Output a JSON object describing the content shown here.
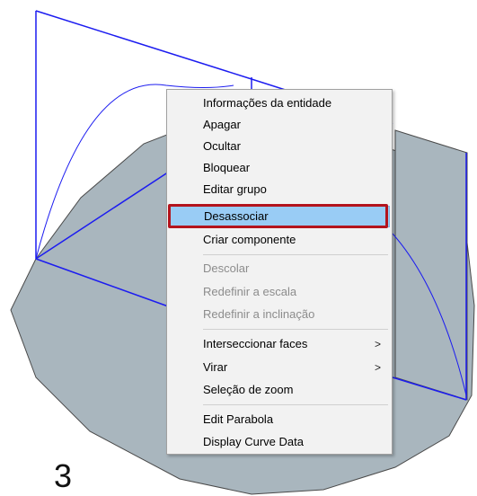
{
  "context_menu": {
    "items": [
      {
        "label": "Informações da entidade"
      },
      {
        "label": "Apagar"
      },
      {
        "label": "Ocultar"
      },
      {
        "label": "Bloquear"
      },
      {
        "label": "Editar grupo"
      },
      {
        "label": "Desassociar"
      },
      {
        "label": "Criar componente"
      },
      {
        "label": "Descolar"
      },
      {
        "label": "Redefinir a escala"
      },
      {
        "label": "Redefinir a inclinação"
      },
      {
        "label": "Interseccionar faces",
        "submenu_arrow": ">"
      },
      {
        "label": "Virar",
        "submenu_arrow": ">"
      },
      {
        "label": "Seleção de zoom"
      },
      {
        "label": "Edit Parabola"
      },
      {
        "label": "Display Curve Data"
      }
    ],
    "selected_item": "Desassociar",
    "disabled_items": [
      "Descolar",
      "Redefinir a escala",
      "Redefinir a inclinação"
    ]
  },
  "step_label": "3",
  "colors": {
    "edge_blue": "#1c1cf0",
    "face_gray": "#a9b6be",
    "face_outline": "#4a4a4a",
    "highlight_red": "#b3141d",
    "selected_bg": "#99ccf5",
    "menu_bg": "#f2f2f2"
  }
}
